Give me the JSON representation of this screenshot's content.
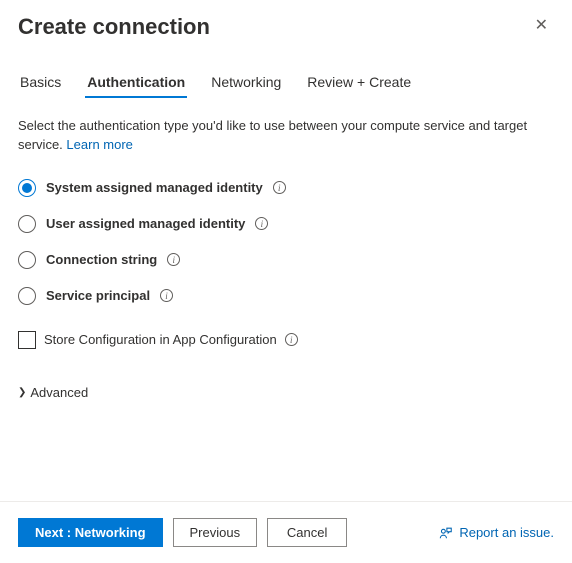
{
  "header": {
    "title": "Create connection"
  },
  "tabs": [
    {
      "label": "Basics",
      "active": false
    },
    {
      "label": "Authentication",
      "active": true
    },
    {
      "label": "Networking",
      "active": false
    },
    {
      "label": "Review + Create",
      "active": false
    }
  ],
  "description": {
    "text": "Select the authentication type you'd like to use between your compute service and target service.",
    "linkText": "Learn more"
  },
  "authOptions": [
    {
      "label": "System assigned managed identity",
      "selected": true
    },
    {
      "label": "User assigned managed identity",
      "selected": false
    },
    {
      "label": "Connection string",
      "selected": false
    },
    {
      "label": "Service principal",
      "selected": false
    }
  ],
  "checkbox": {
    "label": "Store Configuration in App Configuration",
    "checked": false
  },
  "advanced": {
    "label": "Advanced"
  },
  "footer": {
    "primary": "Next : Networking",
    "previous": "Previous",
    "cancel": "Cancel",
    "report": "Report an issue."
  }
}
